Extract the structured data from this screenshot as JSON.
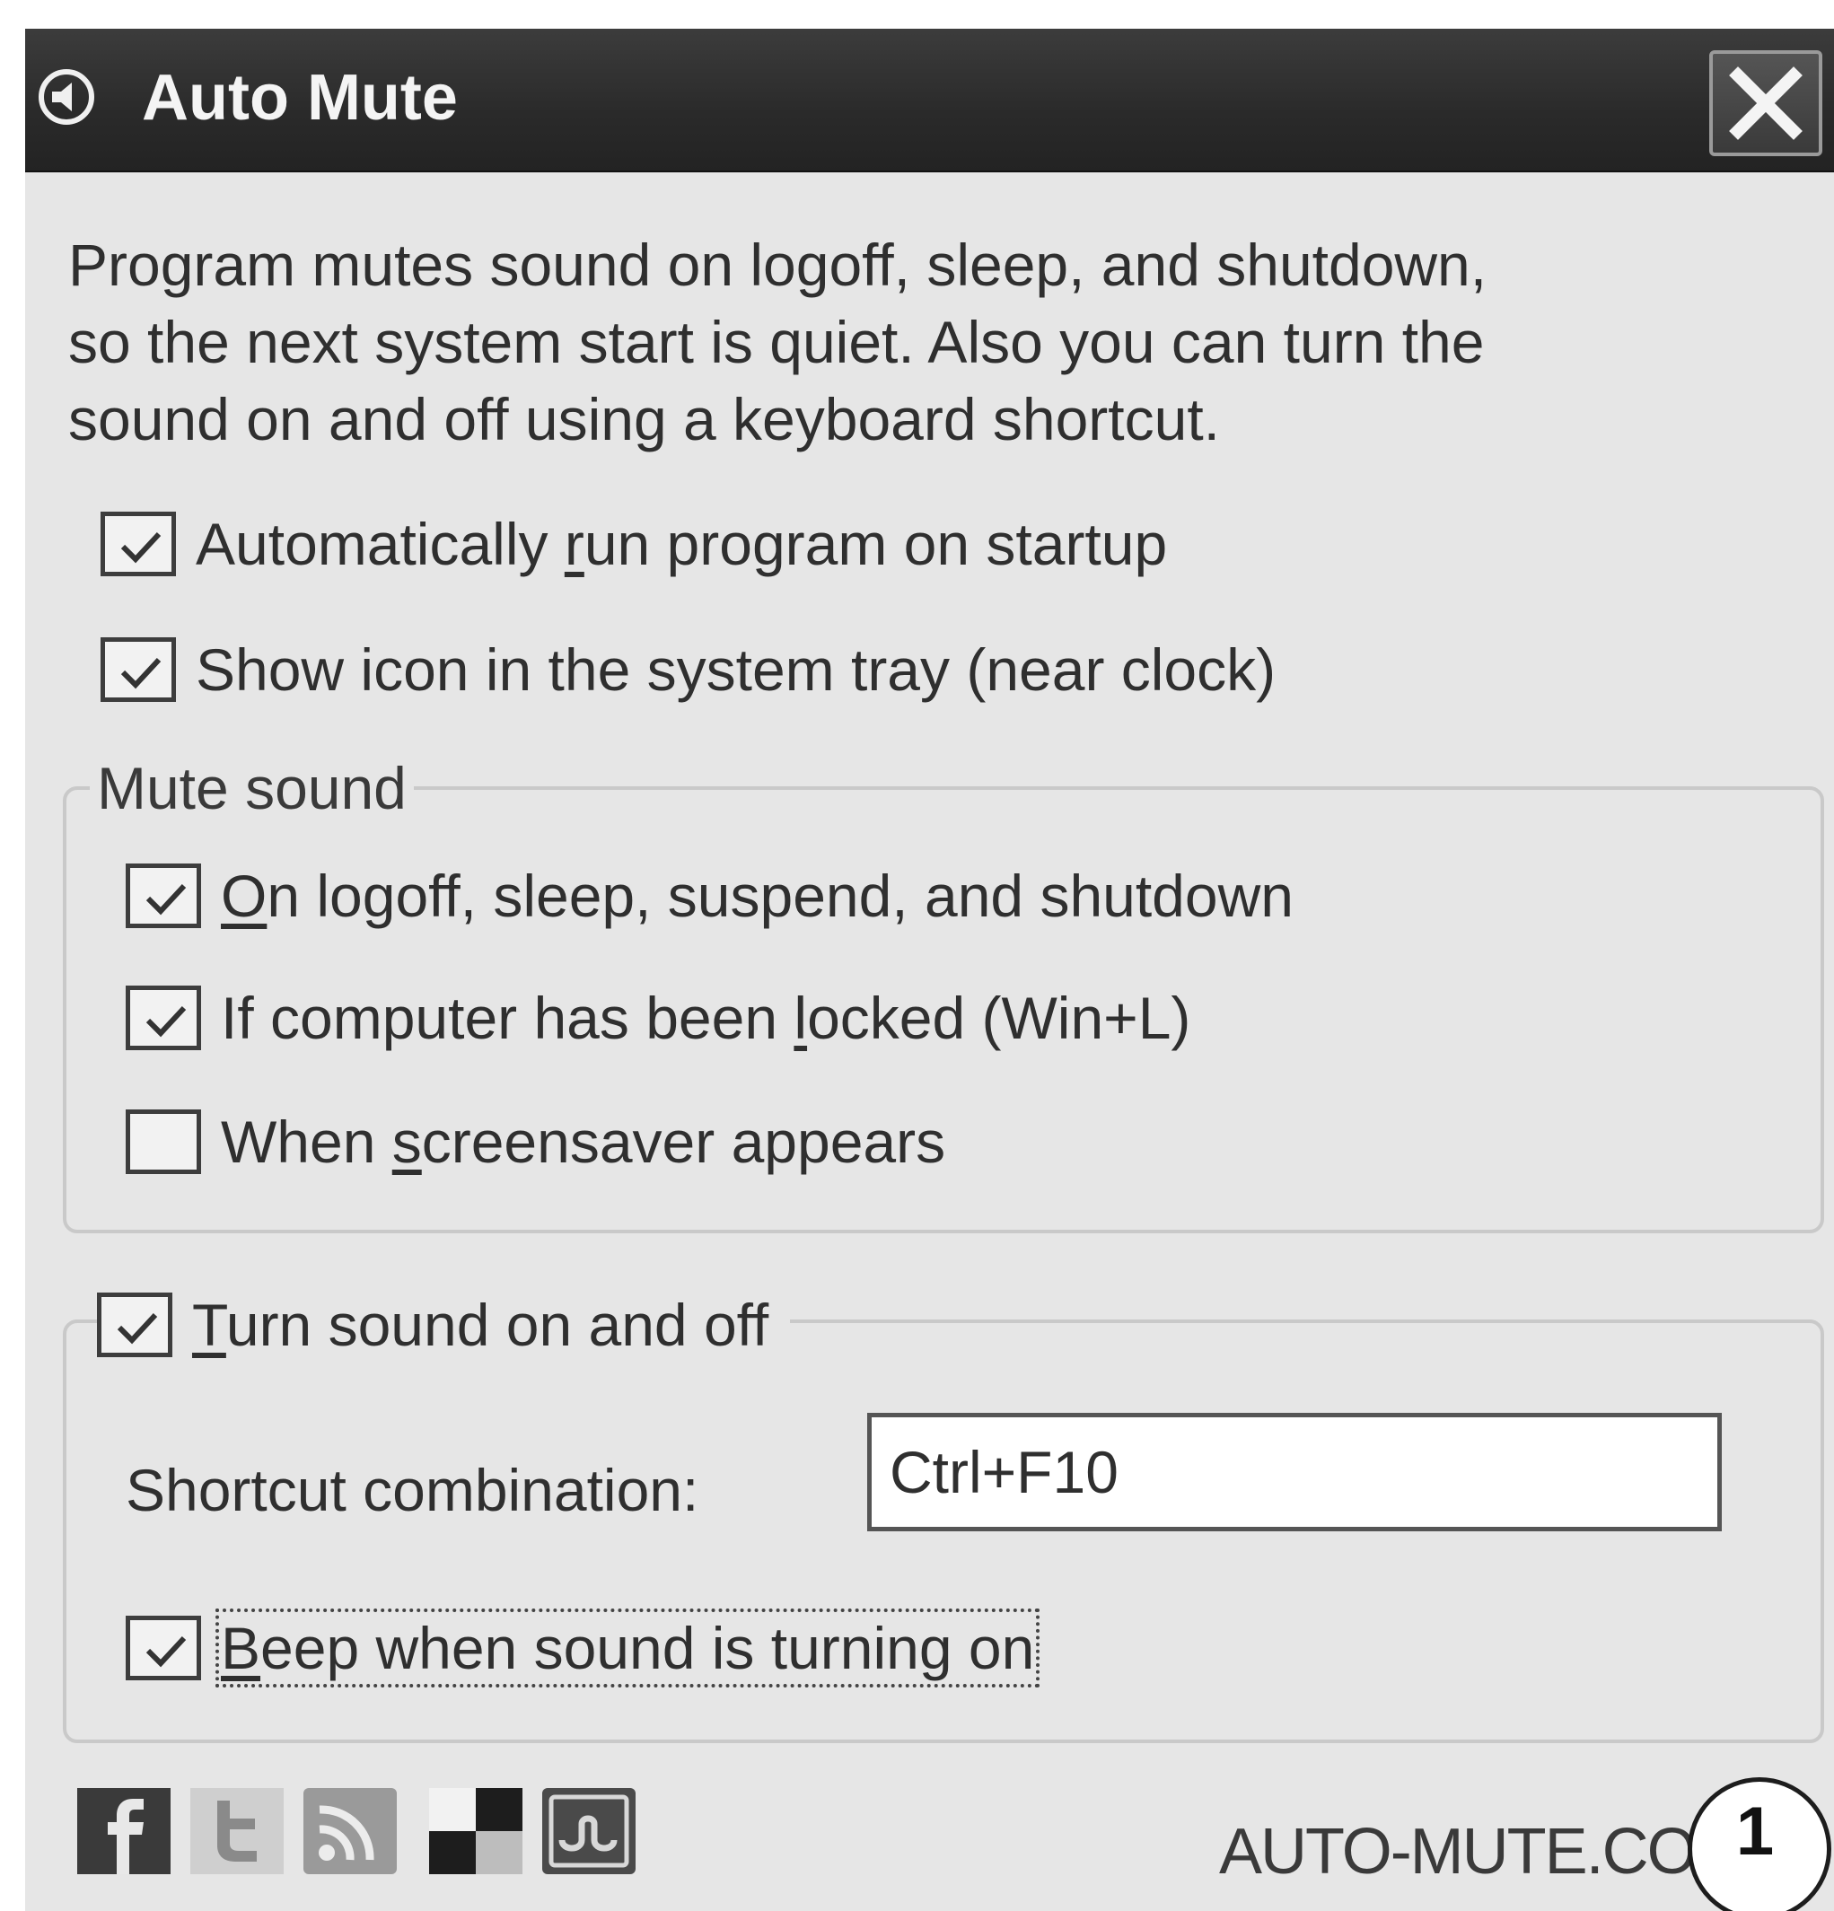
{
  "window": {
    "title": "Auto Mute",
    "close_icon": "close-icon",
    "app_icon": "speaker-icon"
  },
  "description": {
    "line1": "Program mutes sound on logoff, sleep, and shutdown,",
    "line2": "so the next system start is quiet. Also you can turn the",
    "line3": "sound on and off using a keyboard shortcut."
  },
  "options": {
    "autorun": {
      "label_pre": "Automatically ",
      "label_u": "r",
      "label_post": "un program on startup",
      "checked": true
    },
    "tray": {
      "label": "Show icon in the system tray (near clock)",
      "checked": true
    }
  },
  "mute_group": {
    "legend": "Mute sound",
    "logoff": {
      "label_u": "O",
      "label_post": "n logoff, sleep, suspend, and shutdown",
      "checked": true
    },
    "locked": {
      "label_pre": "If computer has been ",
      "label_u": "l",
      "label_post": "ocked (Win+L)",
      "checked": true
    },
    "screensaver": {
      "label_pre": "When ",
      "label_u": "s",
      "label_post": "creensaver appears",
      "checked": false
    }
  },
  "toggle_group": {
    "enable": {
      "label_u": "T",
      "label_post": "urn sound on and off",
      "checked": true
    },
    "shortcut_label": "Shortcut combination:",
    "shortcut_value": "Ctrl+F10",
    "beep": {
      "label_u": "B",
      "label_post": "eep when sound is turning on",
      "checked": true
    }
  },
  "footer": {
    "icons": [
      "facebook-icon",
      "twitter-icon",
      "rss-icon",
      "delicious-icon",
      "stumbleupon-icon"
    ],
    "site": "AUTO-MUTE.CO",
    "badge": "1"
  },
  "colors": {
    "titlebar": "#2a2a2a",
    "window_bg": "#e6e6e6",
    "text": "#2f2f2f"
  }
}
